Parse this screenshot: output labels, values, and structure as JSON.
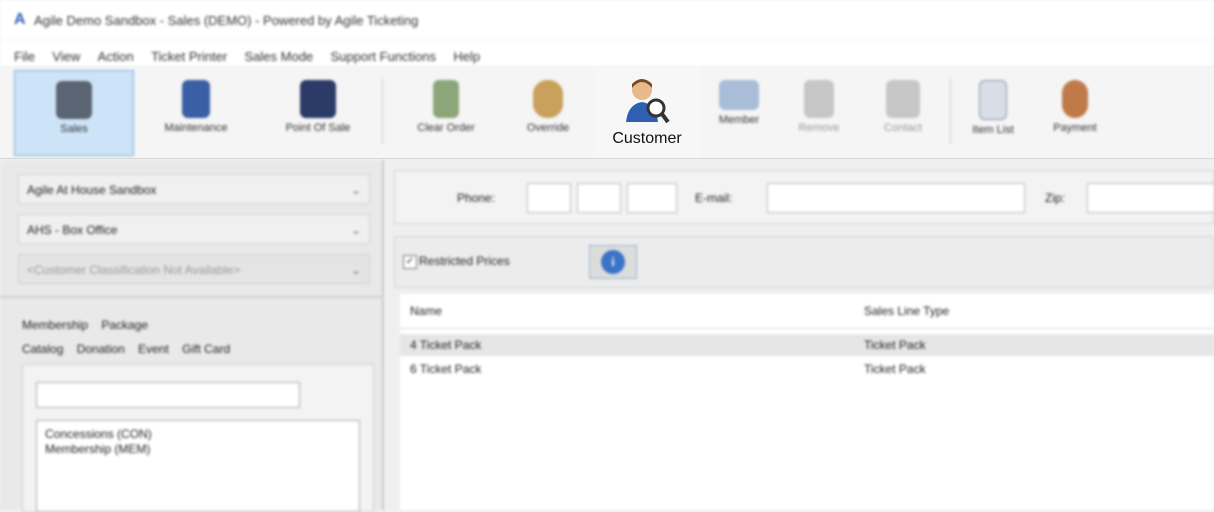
{
  "window": {
    "title": "Agile Demo Sandbox - Sales (DEMO) - Powered by Agile Ticketing",
    "logo": "A"
  },
  "menu": [
    "File",
    "View",
    "Action",
    "Ticket Printer",
    "Sales Mode",
    "Support Functions",
    "Help"
  ],
  "toolbar": {
    "sales": "Sales",
    "maintenance": "Maintenance",
    "point_of_sale": "Point Of Sale",
    "clear_order": "Clear Order",
    "override": "Override",
    "customer": "Customer",
    "member": "Member",
    "remove": "Remove",
    "contact": "Contact",
    "item_list": "Item List",
    "payment": "Payment"
  },
  "left": {
    "organization": "Agile At House Sandbox",
    "location": "AHS - Box Office",
    "classification": "<Customer Classification Not Available>",
    "tabs_row1": [
      "Membership",
      "Package"
    ],
    "tabs_row2": [
      "Catalog",
      "Donation",
      "Event",
      "Gift Card"
    ],
    "search_value": "",
    "catalog_items": [
      "Concessions (CON)",
      "Membership (MEM)"
    ]
  },
  "filters": {
    "phone_label": "Phone:",
    "email_label": "E-mail:",
    "zip_label": "Zip:"
  },
  "options": {
    "restricted_prices_label": "Restricted Prices",
    "restricted_prices_checked": "✓",
    "info_icon": "i"
  },
  "grid": {
    "columns": [
      "Name",
      "Sales Line Type"
    ],
    "rows": [
      {
        "name": "4 Ticket Pack",
        "type": "Ticket Pack"
      },
      {
        "name": "6 Ticket Pack",
        "type": "Ticket Pack"
      }
    ]
  },
  "colors": {
    "accent": "#2d62b8",
    "active_button": "#cde3f7"
  }
}
